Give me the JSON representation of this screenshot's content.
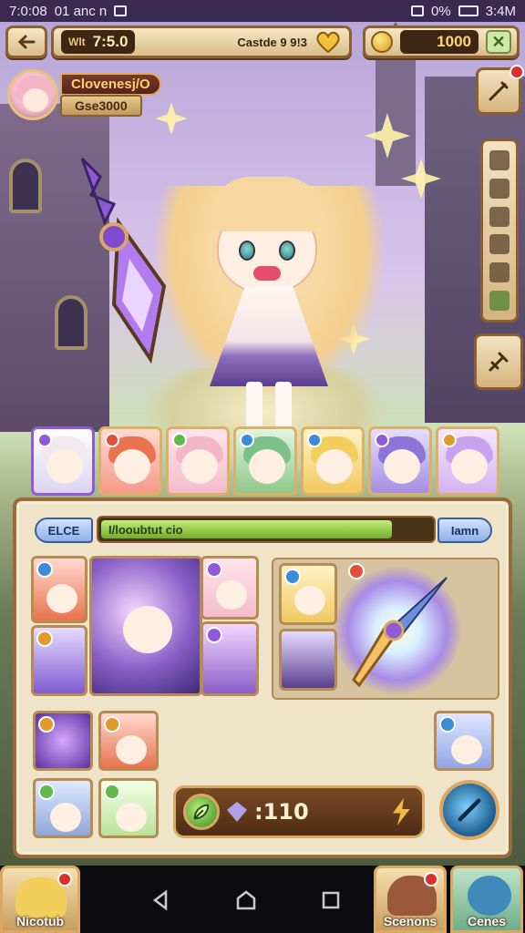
{
  "status_bar": {
    "time": "7:0:08",
    "carrier": "01 anc n",
    "battery": "0%",
    "clock_right": "3:4M"
  },
  "top_bar": {
    "level_label": "Wlt",
    "level_value": "7:5.0",
    "stage_text": "Castde 9 9!3",
    "gold_value": "1000"
  },
  "player": {
    "name": "Clovenesj/O",
    "gold": "Gse3000"
  },
  "panel": {
    "tab_left": "ELCE",
    "progress_text": "I/looubtut cio",
    "progress_fraction": 0.88,
    "tab_right": "Iamn"
  },
  "action": {
    "value": ":110"
  },
  "bottom_nav": {
    "left_label": "Nicotub",
    "mid_label": "Scenons",
    "right_label": "Cenes"
  },
  "colors": {
    "frame": "#8b5e34",
    "accent_green": "#6fae2a",
    "panel_bg": "#efe3c8"
  }
}
